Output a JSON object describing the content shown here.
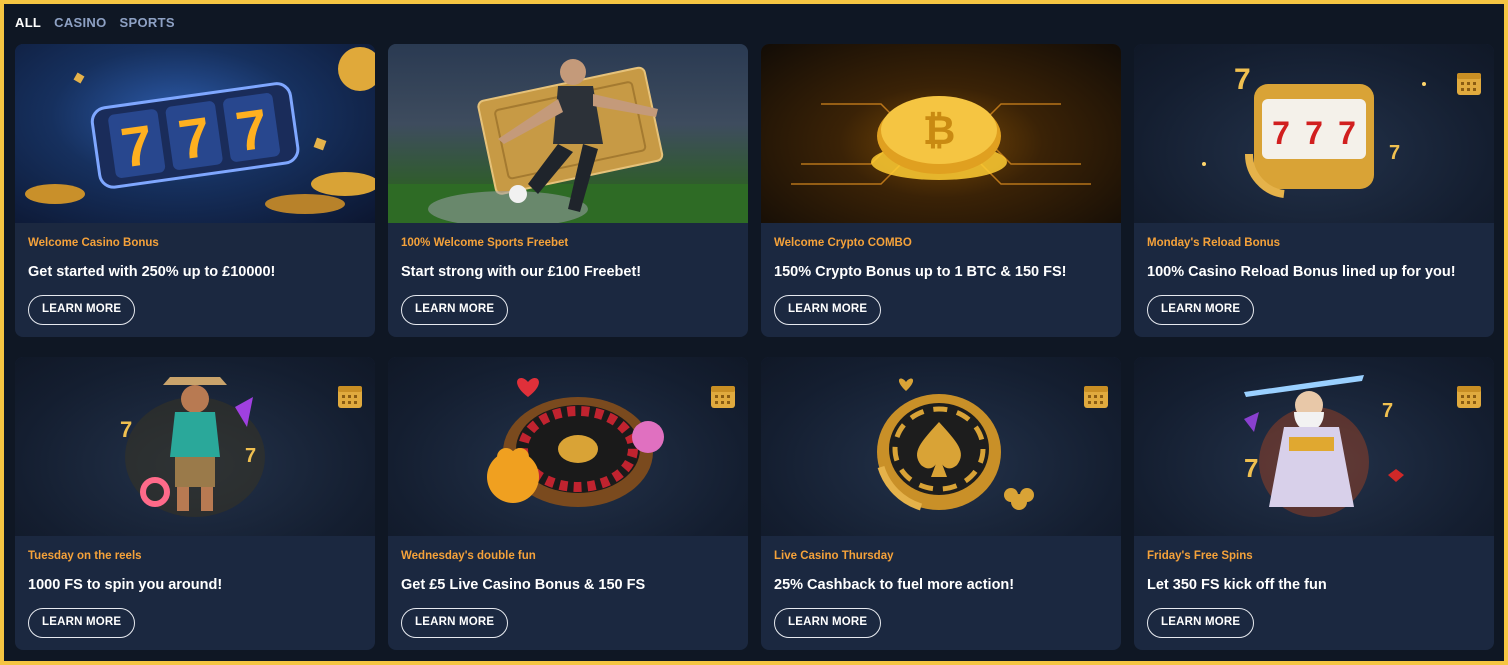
{
  "tabs": [
    {
      "label": "ALL",
      "active": true
    },
    {
      "label": "CASINO",
      "active": false
    },
    {
      "label": "SPORTS",
      "active": false
    }
  ],
  "colors": {
    "accent": "#f5a23a",
    "card": "#1b2840",
    "background": "#0f1724",
    "border": "#f5c542"
  },
  "cards": [
    {
      "subtitle": "Welcome Casino Bonus",
      "headline": "Get started with 250% up to £10000!",
      "button": "LEARN MORE",
      "image": "slot-777-reels"
    },
    {
      "subtitle": "100% Welcome Sports Freebet",
      "headline": "Start strong with our £100 Freebet!",
      "button": "LEARN MORE",
      "image": "football-player-ticket"
    },
    {
      "subtitle": "Welcome Crypto COMBO",
      "headline": "150% Crypto Bonus up to 1 BTC & 150 FS!",
      "button": "LEARN MORE",
      "image": "bitcoin-coin"
    },
    {
      "subtitle": "Monday's Reload Bonus",
      "headline": "100% Casino Reload Bonus lined up for you!",
      "button": "LEARN MORE",
      "image": "slot-machine-reload",
      "calendar": true
    },
    {
      "subtitle": "Tuesday on the reels",
      "headline": "1000 FS to spin you around!",
      "button": "LEARN MORE",
      "image": "cowboy-character",
      "calendar": true
    },
    {
      "subtitle": "Wednesday's double fun",
      "headline": "Get £5 Live Casino Bonus & 150 FS",
      "button": "LEARN MORE",
      "image": "roulette-wheel",
      "calendar": true
    },
    {
      "subtitle": "Live Casino Thursday",
      "headline": "25% Cashback to fuel more action!",
      "button": "LEARN MORE",
      "image": "spade-chip-cashback",
      "calendar": true
    },
    {
      "subtitle": "Friday's Free Spins",
      "headline": "Let 350 FS kick off the fun",
      "button": "LEARN MORE",
      "image": "zeus-character",
      "calendar": true
    }
  ]
}
